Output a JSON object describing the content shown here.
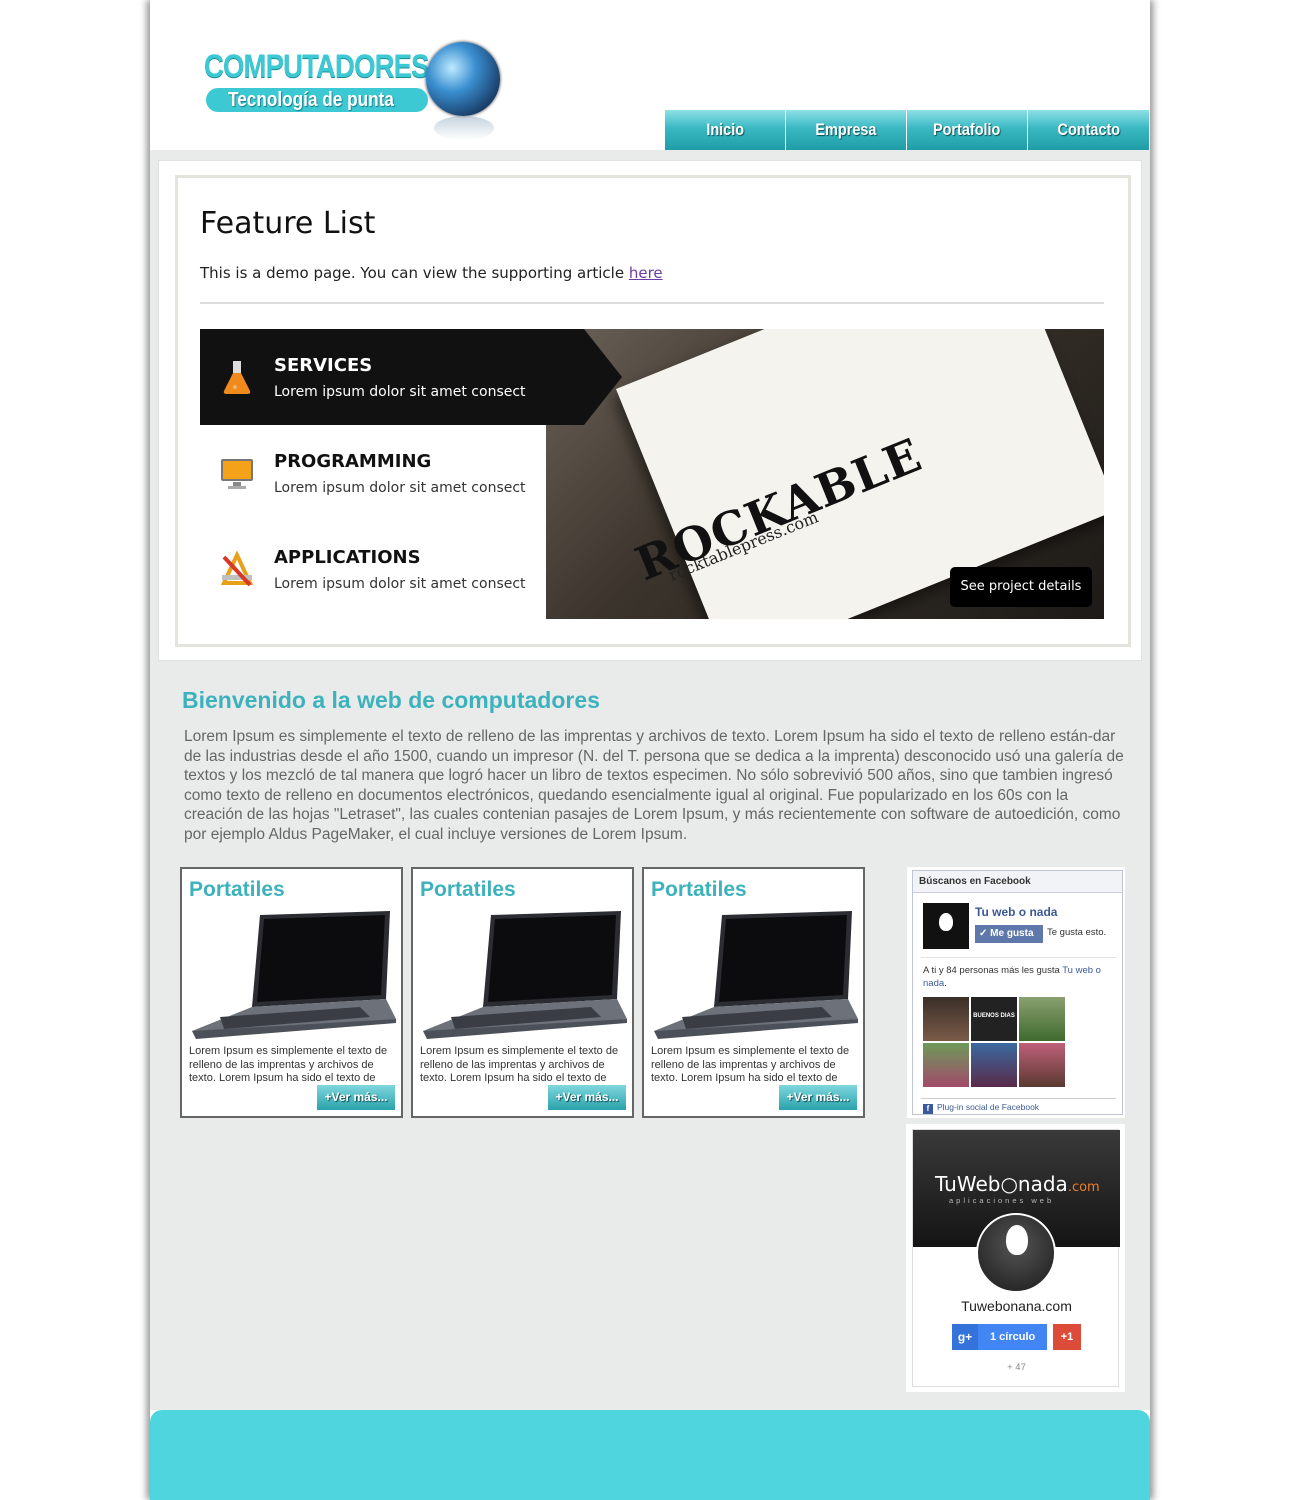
{
  "header": {
    "logo_title": "COMPUTADORES",
    "logo_subtitle": "Tecnología de punta"
  },
  "nav": {
    "items": [
      {
        "label": "Inicio"
      },
      {
        "label": "Empresa"
      },
      {
        "label": "Portafolio"
      },
      {
        "label": "Contacto"
      }
    ]
  },
  "slider": {
    "title": "Feature List",
    "intro": "This is a demo page. You can view the supporting article ",
    "intro_link": "here",
    "features": [
      {
        "title": "SERVICES",
        "desc": "Lorem ipsum dolor sit amet consect",
        "icon": "flask-icon",
        "active": true
      },
      {
        "title": "PROGRAMMING",
        "desc": "Lorem ipsum dolor sit amet consect",
        "icon": "monitor-icon",
        "active": false
      },
      {
        "title": "APPLICATIONS",
        "desc": "Lorem ipsum dolor sit amet consect",
        "icon": "pencil-ruler-icon",
        "active": false
      }
    ],
    "image": {
      "brand": "ROCKABLE",
      "brand_sub": "rocktablepress.com",
      "button": "See project details"
    }
  },
  "welcome": {
    "title": "Bienvenido a la web de computadores",
    "text": "Lorem Ipsum es simplemente el texto de relleno de las imprentas y archivos de texto. Lorem Ipsum ha sido el texto de relleno están-dar de las industrias desde el año 1500, cuando un impresor (N. del T. persona que se dedica a la imprenta) desconocido usó una galería de textos y los mezcló de tal manera que logró hacer un libro de textos especimen. No sólo sobrevivió 500 años, sino que tambien ingresó como texto de relleno en documentos electrónicos, quedando esencialmente igual al original. Fue popularizado en los 60s con la creación de las hojas \"Letraset\", las cuales contenian pasajes de Lorem Ipsum, y más recientemente con software de autoedición, como por ejemplo Aldus PageMaker, el cual incluye versiones de Lorem Ipsum."
  },
  "products": [
    {
      "title": "Portatiles",
      "text": "Lorem Ipsum es simplemente el texto de relleno de las imprentas y archivos de texto. Lorem Ipsum ha sido el texto de",
      "button": "+Ver más..."
    },
    {
      "title": "Portatiles",
      "text": "Lorem Ipsum es simplemente el texto de relleno de las imprentas y archivos de texto. Lorem Ipsum ha sido el texto de",
      "button": "+Ver más..."
    },
    {
      "title": "Portatiles",
      "text": "Lorem Ipsum es simplemente el texto de relleno de las imprentas y archivos de texto. Lorem Ipsum ha sido el texto de",
      "button": "+Ver más..."
    }
  ],
  "facebook": {
    "header": "Búscanos en Facebook",
    "page_name": "Tu web o nada",
    "like_button": "Me gusta",
    "like_note": "Te gusta esto.",
    "friends_text": "A ti y 84 personas más les gusta ",
    "friends_link": "Tu web o nada",
    "friends_end": ".",
    "photo_caption": "BUENOS DIAS PAIS SUMISO",
    "footer": "Plug-in social de Facebook"
  },
  "google": {
    "cover_logo": "TuWeb",
    "cover_logo_end": "nada",
    "cover_logo_suffix": ".com",
    "cover_sub": "aplicaciones web",
    "name": "Tuwebonana.com",
    "follow": "1 círculo",
    "plus": "+1",
    "count": "+ 47"
  },
  "colors": {
    "accent": "#3db2bc",
    "nav": "#2aa2ab",
    "footer": "#4fd5dd",
    "content_bg": "#e9ebeb"
  }
}
